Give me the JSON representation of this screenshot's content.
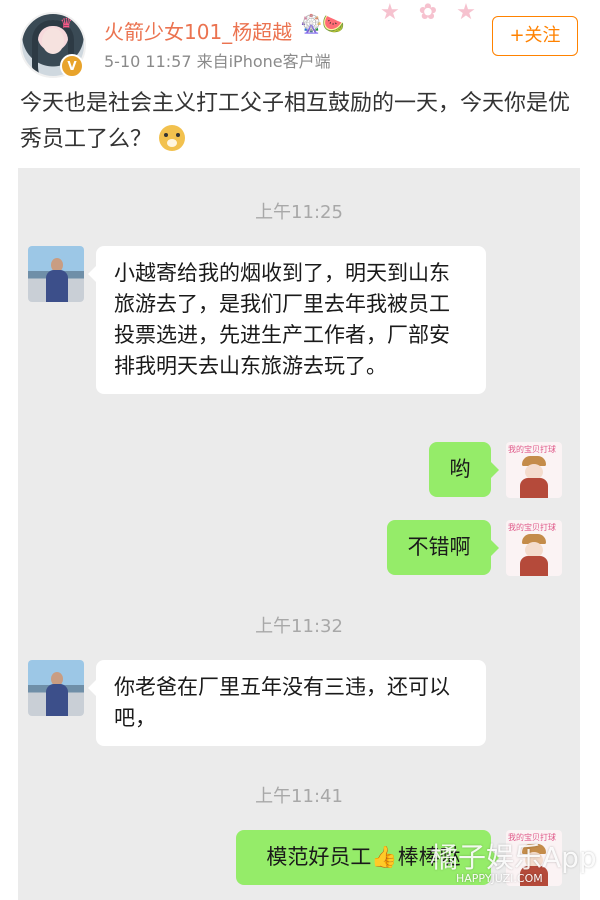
{
  "header": {
    "username": "火箭少女101_杨超越",
    "badges": "🎡🍉",
    "timestamp": "5-10 11:57",
    "source": "来自iPhone客户端",
    "follow_label": "+关注",
    "verified_mark": "V"
  },
  "post": {
    "text": "今天也是社会主义打工父子相互鼓励的一天，今天你是优秀员工了么？"
  },
  "chat": {
    "messages": [
      {
        "type": "time",
        "text": "上午11:25"
      },
      {
        "type": "received",
        "text": "小越寄给我的烟收到了，明天到山东旅游去了，是我们厂里去年我被员工投票选进，先进生产工作者，厂部安排我明天去山东旅游去玩了。"
      },
      {
        "type": "sent",
        "text": "哟"
      },
      {
        "type": "sent",
        "text": "不错啊"
      },
      {
        "type": "time",
        "text": "上午11:32"
      },
      {
        "type": "received",
        "text": "你老爸在厂里五年没有三违，还可以吧，"
      },
      {
        "type": "time",
        "text": "上午11:41"
      },
      {
        "type": "sent",
        "text": "模范好员工👍棒棒哒"
      }
    ],
    "sticker_text": "我的宝贝打球"
  },
  "watermark": {
    "main": "橘子娱乐App",
    "sub": "HAPPYJUZI.COM"
  },
  "colors": {
    "username": "#eb7350",
    "follow": "#ff8200",
    "sent_bubble": "#95ec69",
    "received_bubble": "#ffffff",
    "chat_bg": "#ebebeb"
  }
}
